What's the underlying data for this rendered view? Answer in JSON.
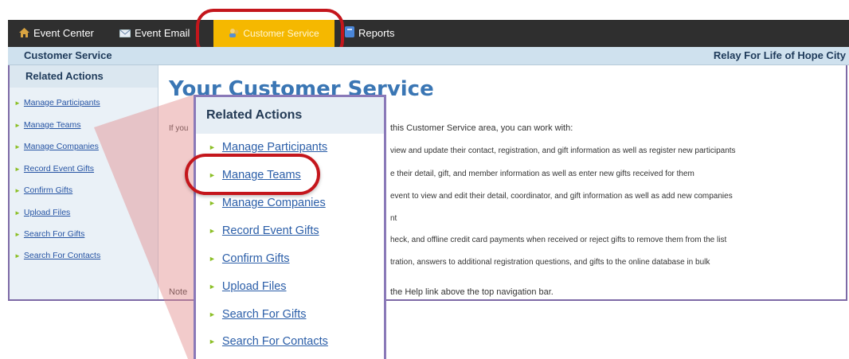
{
  "top_nav": {
    "items": [
      {
        "label": "Event Center",
        "icon": "home-icon"
      },
      {
        "label": "Event Email",
        "icon": "email-icon"
      },
      {
        "label": "Customer Service",
        "icon": "customer-service-icon",
        "active": true
      },
      {
        "label": "Reports",
        "icon": "reports-icon"
      }
    ]
  },
  "subheader": {
    "section_title": "Customer Service",
    "event_name": "Relay For Life of Hope City"
  },
  "sidebar": {
    "heading": "Related Actions",
    "items": [
      {
        "label": "Manage Participants"
      },
      {
        "label": "Manage Teams"
      },
      {
        "label": "Manage Companies"
      },
      {
        "label": "Record Event Gifts"
      },
      {
        "label": "Confirm Gifts"
      },
      {
        "label": "Upload Files"
      },
      {
        "label": "Search For Gifts"
      },
      {
        "label": "Search For Contacts"
      }
    ]
  },
  "main": {
    "title": "Your Customer Service",
    "intro_start": "If you",
    "intro_end": "this Customer Service area, you can work with:",
    "lines": [
      "view and update their contact, registration, and gift information as well as register new participants",
      "e their detail, gift, and member information as well as enter new gifts received for them",
      "event to view and edit their detail, coordinator, and gift information as well as add new companies",
      "nt",
      "heck, and offline credit card payments when received or reject gifts to remove them from the list",
      "tration, answers to additional registration questions, and gifts to the online database in bulk"
    ],
    "note_start": "Note",
    "note_end": "the Help link above the top navigation bar."
  },
  "popup": {
    "heading": "Related Actions",
    "items": [
      {
        "label": "Manage Participants"
      },
      {
        "label": "Manage Teams"
      },
      {
        "label": "Manage Companies"
      },
      {
        "label": "Record Event Gifts"
      },
      {
        "label": "Confirm Gifts"
      },
      {
        "label": "Upload Files"
      },
      {
        "label": "Search For Gifts"
      },
      {
        "label": "Search For Contacts"
      }
    ]
  },
  "colors": {
    "nav_bg": "#2f2f2f",
    "active_tab": "#f5b800",
    "highlight_oval": "#c4161c",
    "link": "#2553a3",
    "title": "#3a76b4",
    "frame_border": "#7d6aa6"
  }
}
